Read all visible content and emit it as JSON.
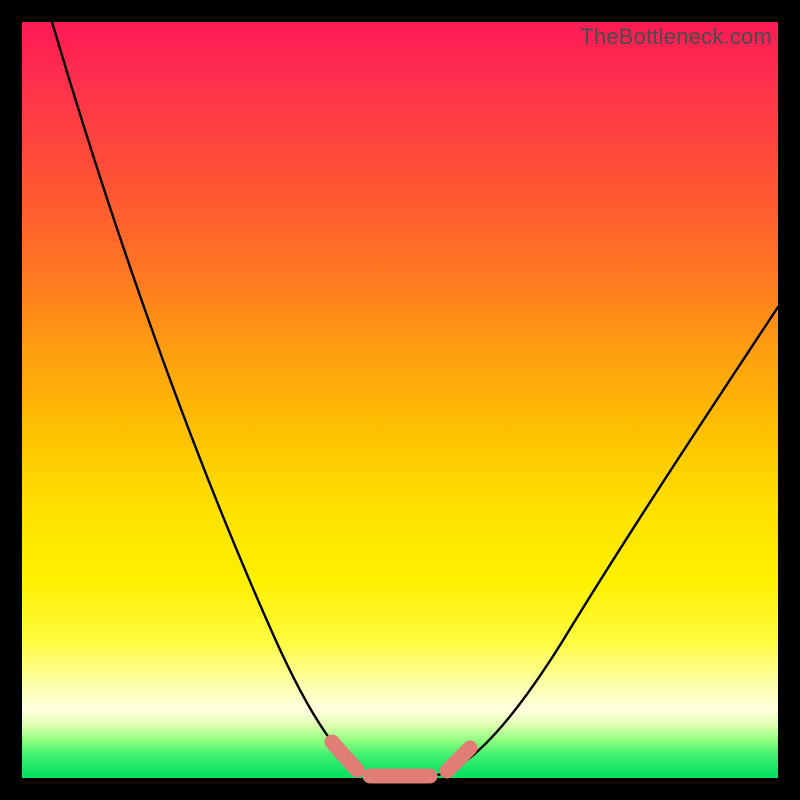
{
  "watermark": "TheBottleneck.com",
  "chart_data": {
    "type": "line",
    "title": "",
    "xlabel": "",
    "ylabel": "",
    "xlim": [
      0,
      100
    ],
    "ylim": [
      0,
      100
    ],
    "grid": false,
    "series": [
      {
        "name": "bottleneck-curve",
        "x": [
          4,
          10,
          16,
          22,
          28,
          33,
          37,
          40,
          43,
          45,
          48,
          52,
          55,
          58,
          62,
          68,
          76,
          85,
          94,
          100
        ],
        "y": [
          100,
          84,
          68,
          52,
          36,
          22,
          12,
          6,
          2,
          0.5,
          0,
          0,
          0.5,
          2,
          6,
          14,
          26,
          40,
          54,
          63
        ]
      }
    ],
    "annotations": [
      {
        "name": "trough-marker",
        "x_range": [
          42,
          58
        ],
        "y": 0
      }
    ],
    "colors": {
      "curve": "#000000",
      "marker": "#df7d76",
      "background_top": "#ff1a55",
      "background_bottom": "#00e060",
      "frame": "#000000"
    }
  }
}
